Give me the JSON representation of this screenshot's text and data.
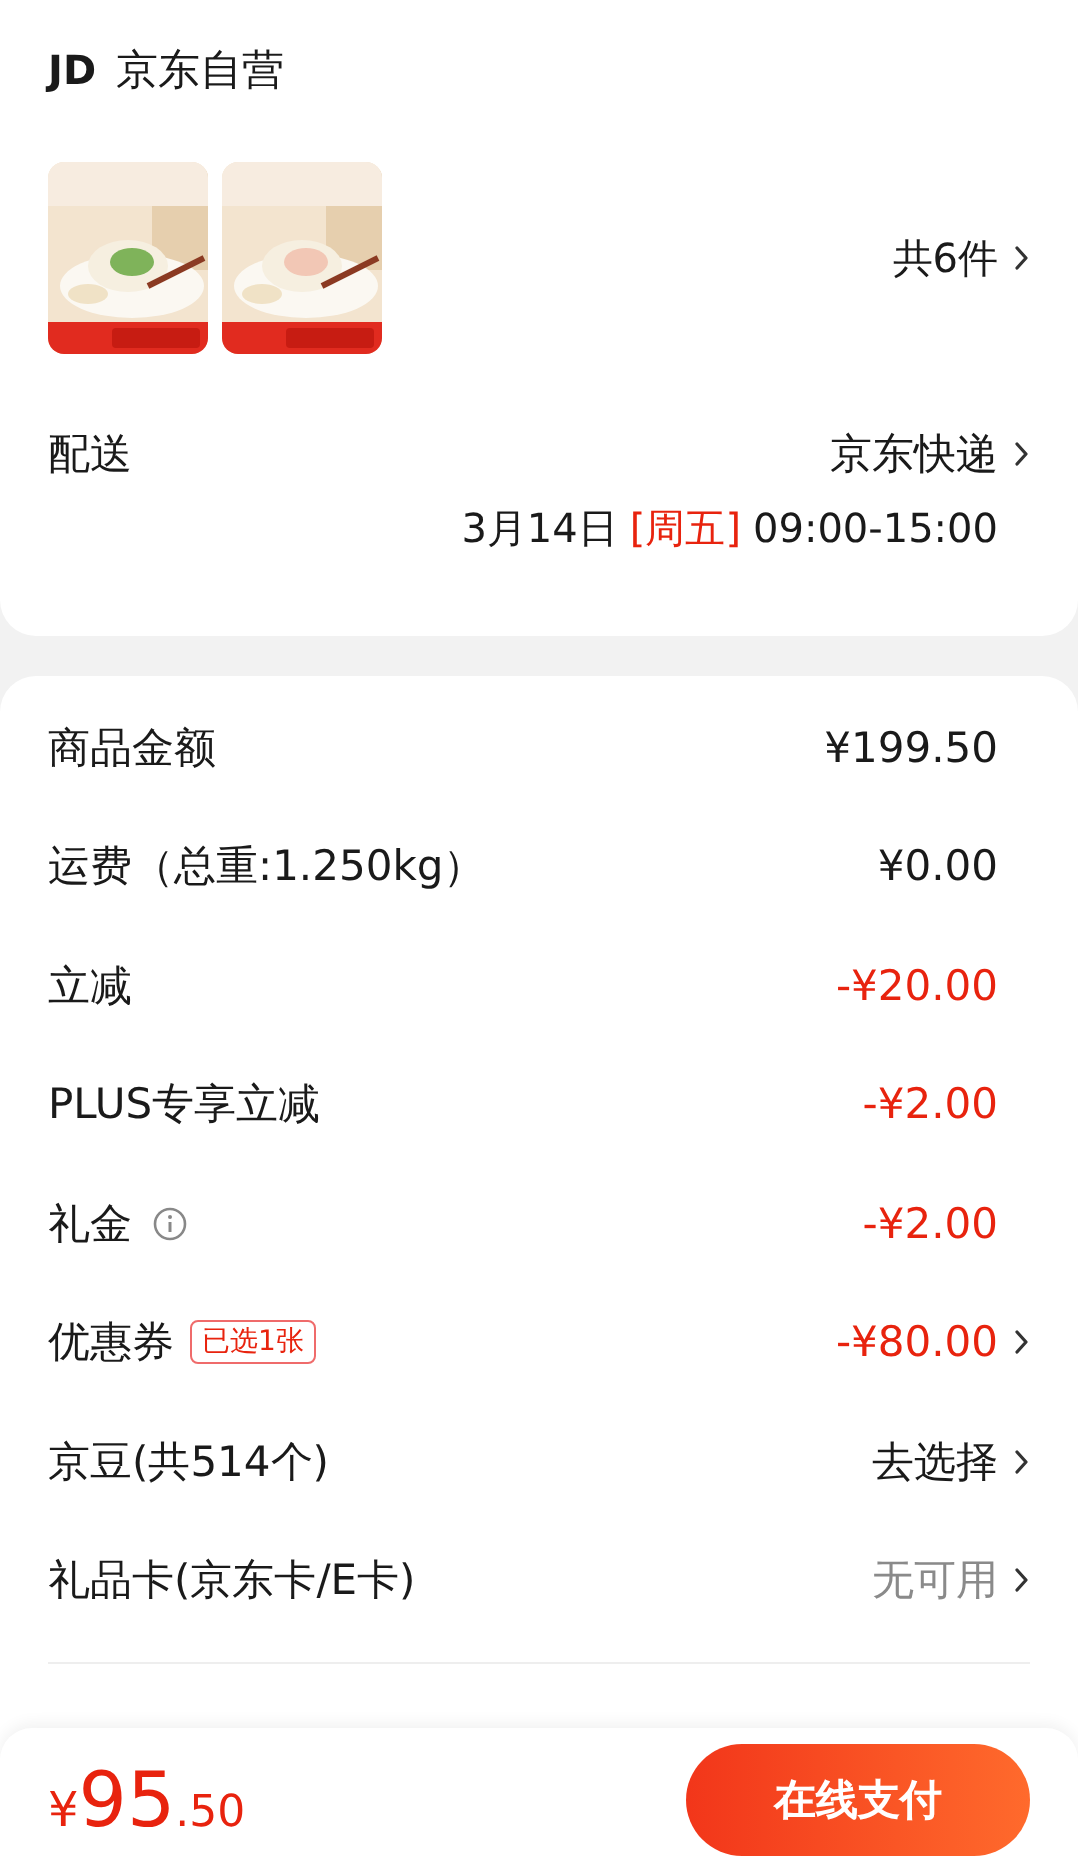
{
  "store": {
    "logo": "JD",
    "name": "京东自营"
  },
  "item_count": "共6件",
  "delivery": {
    "label": "配送",
    "method": "京东快递",
    "date": "3月14日",
    "weekday": "[周五]",
    "time": "09:00-15:00"
  },
  "fee_rows": [
    {
      "label": "商品金额",
      "value": "¥199.50",
      "kind": "amount"
    },
    {
      "label": "运费（总重:1.250kg）",
      "value": "¥0.00",
      "kind": "amount"
    },
    {
      "label": "立减",
      "value": "-¥20.00",
      "kind": "discount"
    },
    {
      "label": "PLUS专享立减",
      "value": "-¥2.00",
      "kind": "discount"
    },
    {
      "label": "礼金",
      "info": true,
      "value": "-¥2.00",
      "kind": "discount"
    },
    {
      "label": "优惠券",
      "badge": "已选1张",
      "value": "-¥80.00",
      "kind": "discount",
      "chevron": true
    },
    {
      "label": "京豆(共514个)",
      "value": "去选择",
      "kind": "action",
      "chevron": true
    },
    {
      "label": "礼品卡(京东卡/E卡)",
      "value": "无可用",
      "kind": "unavailable",
      "chevron": true
    }
  ],
  "bottom_bar": {
    "currency": "¥",
    "integer": "95",
    "decimals": ".50",
    "pay_button": "在线支付"
  }
}
